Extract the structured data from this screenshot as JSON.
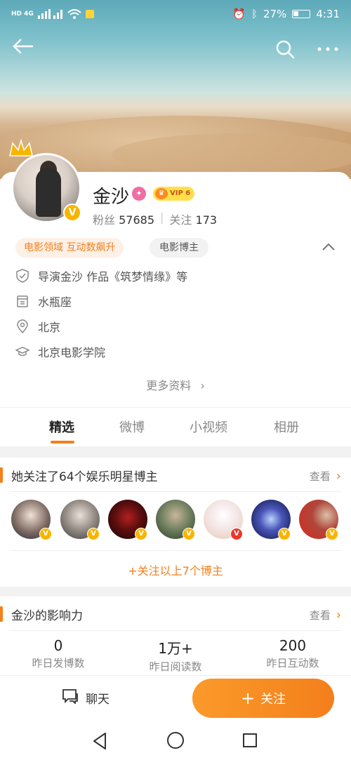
{
  "status_bar": {
    "network_left": "HD 4G",
    "battery": "27%",
    "time": "4:31"
  },
  "nav": {
    "back_icon": "back-arrow-icon",
    "search_icon": "search-icon",
    "more_icon": "more-dots-icon"
  },
  "profile": {
    "name": "金沙",
    "vip_label": "VIP 6",
    "fans_label": "粉丝",
    "fans_count": "57685",
    "follow_label": "关注",
    "follow_count": "173",
    "tag_domain": "电影领域 互动数飙升",
    "tag_role": "电影博主",
    "info": [
      {
        "icon": "shield-icon",
        "text": "导演金沙 作品《筑梦情缘》等"
      },
      {
        "icon": "calendar-icon",
        "text": "水瓶座"
      },
      {
        "icon": "location-icon",
        "text": "北京"
      },
      {
        "icon": "graduation-icon",
        "text": "北京电影学院"
      }
    ],
    "more_info": "更多资料",
    "more_info_chevron": "›"
  },
  "tabs": [
    {
      "label": "精选",
      "active": true
    },
    {
      "label": "微博",
      "active": false
    },
    {
      "label": "小视频",
      "active": false
    },
    {
      "label": "相册",
      "active": false
    }
  ],
  "following_section": {
    "title": "她关注了64个娱乐明星博主",
    "view_label": "查看",
    "follow_all_label": "+关注以上7个博主"
  },
  "influence_section": {
    "title": "金沙的影响力",
    "view_label": "查看",
    "metrics": [
      {
        "value": "0",
        "label": "昨日发博数"
      },
      {
        "value": "1万+",
        "label": "昨日阅读数"
      },
      {
        "value": "200",
        "label": "昨日互动数"
      }
    ]
  },
  "actions": {
    "chat_label": "聊天",
    "follow_label": "关注",
    "follow_plus": "+"
  },
  "colors": {
    "accent": "#f47f1b",
    "badge_gold": "#f7b500"
  }
}
